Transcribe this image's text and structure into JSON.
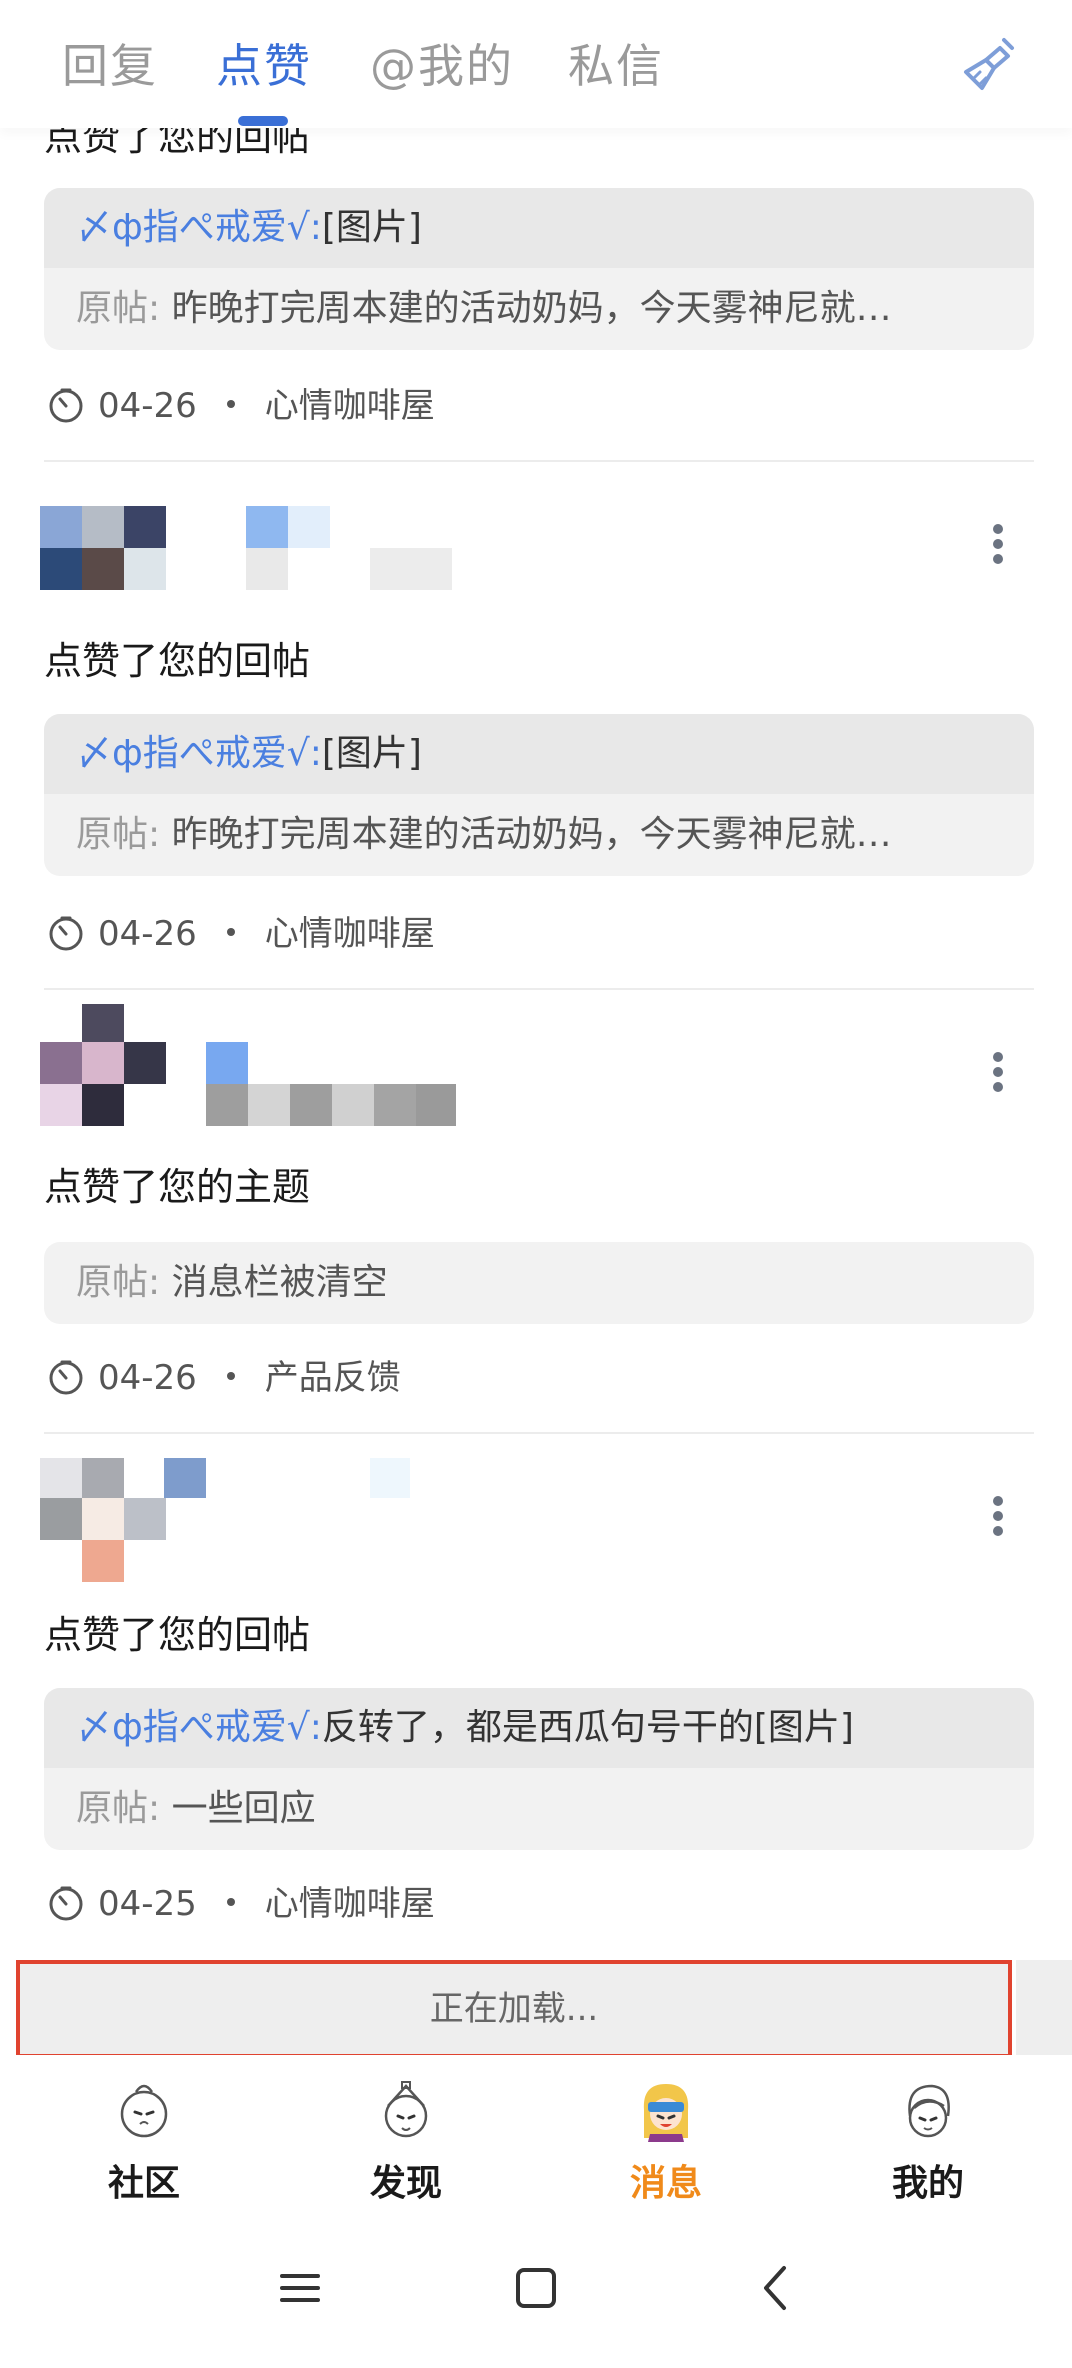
{
  "tabs": [
    {
      "label": "回复"
    },
    {
      "label": "点赞"
    },
    {
      "label": "@我的"
    },
    {
      "label": "私信"
    }
  ],
  "active_tab": "点赞",
  "accent_color": "#3a6fd6",
  "items": [
    {
      "action": "点赞了您的回帖",
      "reply_author": "〆ф指ぺ戒爱√:",
      "reply_text": "[图片]",
      "orig_label": "原帖:",
      "orig_text": "昨晚打完周本建的活动奶妈，今天雾神尼就…",
      "date": "04-26",
      "forum": "心情咖啡屋"
    },
    {
      "action": "点赞了您的回帖",
      "reply_author": "〆ф指ぺ戒爱√:",
      "reply_text": "[图片]",
      "orig_label": "原帖:",
      "orig_text": "昨晚打完周本建的活动奶妈，今天雾神尼就…",
      "date": "04-26",
      "forum": "心情咖啡屋"
    },
    {
      "action": "点赞了您的主题",
      "orig_label": "原帖:",
      "orig_text": "消息栏被清空",
      "date": "04-26",
      "forum": "产品反馈"
    },
    {
      "action": "点赞了您的回帖",
      "reply_author": "〆ф指ぺ戒爱√:",
      "reply_text": "反转了，都是西瓜句号干的[图片]",
      "orig_label": "原帖:",
      "orig_text": "一些回应",
      "date": "04-25",
      "forum": "心情咖啡屋"
    }
  ],
  "loading_text": "正在加载...",
  "bottom_nav": [
    {
      "label": "社区",
      "icon": "community-mascot-icon"
    },
    {
      "label": "发现",
      "icon": "discover-mascot-icon"
    },
    {
      "label": "消息",
      "icon": "messages-mascot-icon"
    },
    {
      "label": "我的",
      "icon": "profile-mascot-icon"
    }
  ],
  "active_nav": "消息",
  "active_nav_color": "#f08a1a",
  "highlight_color": "#e0432f"
}
